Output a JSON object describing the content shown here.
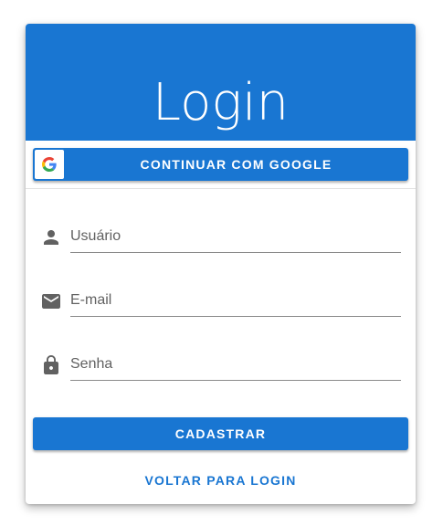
{
  "page": {
    "title": "Login"
  },
  "google": {
    "label": "CONTINUAR COM GOOGLE",
    "icon": "google-g-logo"
  },
  "form": {
    "fields": [
      {
        "icon": "person-icon",
        "placeholder": "Usuário",
        "value": ""
      },
      {
        "icon": "email-icon",
        "placeholder": "E-mail",
        "value": ""
      },
      {
        "icon": "lock-icon",
        "placeholder": "Senha",
        "value": ""
      }
    ],
    "submit_label": "CADASTRAR",
    "back_label": "VOLTAR PARA LOGIN"
  },
  "colors": {
    "primary": "#1976d2",
    "on_primary": "#ffffff",
    "icon": "#616161",
    "underline": "#8a8a8a"
  }
}
